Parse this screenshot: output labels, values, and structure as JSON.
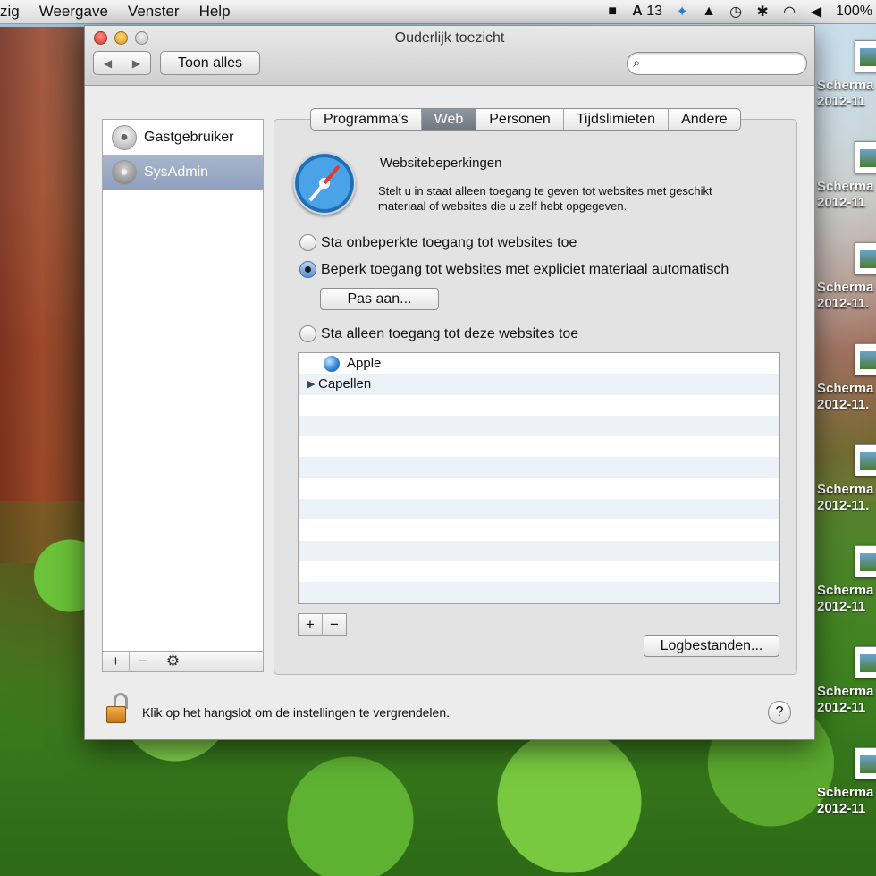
{
  "menubar": {
    "items": [
      "zig",
      "Weergave",
      "Venster",
      "Help"
    ],
    "tray": {
      "evernote": "🐘",
      "adobe_count": "13",
      "adobe": "A",
      "dropbox": "⬡",
      "hat": "🎩",
      "timemachine": "⟲",
      "bluetooth": "ᛒ",
      "wifi": "wifi",
      "volume": "◀",
      "battery": "100%"
    }
  },
  "window": {
    "title": "Ouderlijk toezicht",
    "show_all": "Toon alles",
    "nav_back": "◀",
    "nav_forward": "▶",
    "search_placeholder": ""
  },
  "users": [
    {
      "name": "Gastgebruiker",
      "selected": false
    },
    {
      "name": "SysAdmin",
      "selected": true
    }
  ],
  "list_toolbar": {
    "add": "+",
    "remove": "−",
    "gear": "⚙"
  },
  "tabs": [
    {
      "label": "Programma's",
      "active": false
    },
    {
      "label": "Web",
      "active": true
    },
    {
      "label": "Personen",
      "active": false
    },
    {
      "label": "Tijdslimieten",
      "active": false
    },
    {
      "label": "Andere",
      "active": false
    }
  ],
  "web": {
    "title": "Websitebeperkingen",
    "description": "Stelt u in staat alleen toegang te geven tot websites met geschikt materiaal of websites die u zelf hebt opgegeven.",
    "options": [
      {
        "label": "Sta onbeperkte toegang tot websites toe",
        "checked": false
      },
      {
        "label": "Beperk toegang tot websites met expliciet materiaal automatisch",
        "checked": true
      },
      {
        "label": "Sta alleen toegang tot deze websites toe",
        "checked": false
      }
    ],
    "customize_button": "Pas aan...",
    "sites": [
      {
        "label": "Apple",
        "type": "site"
      },
      {
        "label": "Capellen",
        "type": "folder"
      }
    ],
    "add": "+",
    "remove": "−",
    "logs_button": "Logbestanden..."
  },
  "footer": {
    "lock_text": "Klik op het hangslot om de instellingen te vergrendelen.",
    "help": "?"
  },
  "desktop_icons": [
    {
      "line1": "Scherma",
      "line2": "2012-11"
    },
    {
      "line1": "Scherma",
      "line2": "2012-11"
    },
    {
      "line1": "Scherma",
      "line2": "2012-11."
    },
    {
      "line1": "Scherma",
      "line2": "2012-11."
    },
    {
      "line1": "Scherma",
      "line2": "2012-11."
    },
    {
      "line1": "Scherma",
      "line2": "2012-11"
    },
    {
      "line1": "Scherma",
      "line2": "2012-11"
    },
    {
      "line1": "Scherma",
      "line2": "2012-11"
    }
  ]
}
